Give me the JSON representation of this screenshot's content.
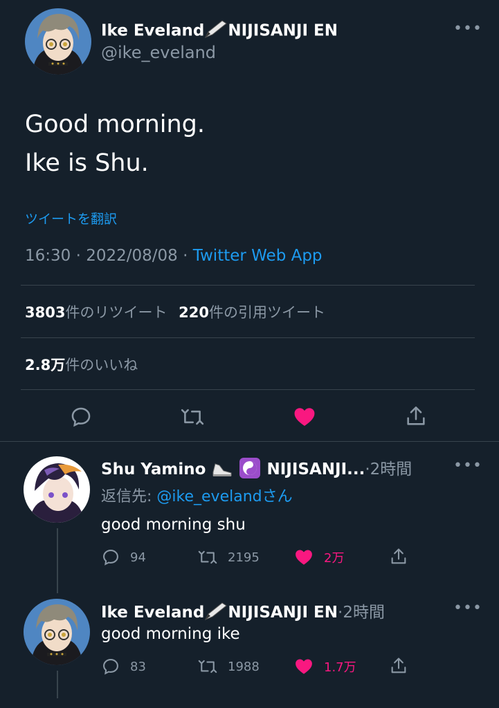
{
  "main_tweet": {
    "display_name": "Ike Eveland",
    "affiliation": "NIJISANJI EN",
    "handle": "@ike_eveland",
    "text_lines": [
      "Good morning.",
      "Ike is Shu."
    ],
    "translate_label": "ツイートを翻訳",
    "meta": {
      "time": "16:30",
      "date": "2022/08/08",
      "source": "Twitter Web App",
      "separator": "·"
    },
    "stats": {
      "retweets_num": "3803",
      "retweets_label": "件のリツイート",
      "quotes_num": "220",
      "quotes_label": "件の引用ツイート",
      "likes_num": "2.8万",
      "likes_label": "件のいいね"
    },
    "more_label": "•••"
  },
  "replies": [
    {
      "display_name": "Shu Yamino",
      "affiliation": "NIJISANJI...",
      "time": "2時間",
      "reply_prefix": "返信先:",
      "reply_to": "@ike_eveland",
      "reply_suffix": "さん",
      "text": "good morning shu",
      "replies": "94",
      "retweets": "2195",
      "likes": "2万",
      "more_label": "•••"
    },
    {
      "display_name": "Ike Eveland",
      "affiliation": "NIJISANJI EN",
      "time": "2時間",
      "text": "good morning ike",
      "replies": "83",
      "retweets": "1988",
      "likes": "1.7万",
      "more_label": "•••"
    }
  ],
  "colors": {
    "background": "#15202b",
    "link": "#1d9bf0",
    "muted": "#8b98a5",
    "like": "#f91880",
    "divider": "#38444d"
  },
  "icons": [
    "reply-icon",
    "retweet-icon",
    "like-icon",
    "share-icon",
    "more-icon",
    "pen-emoji",
    "sneaker-emoji",
    "yin-yang-emoji"
  ]
}
